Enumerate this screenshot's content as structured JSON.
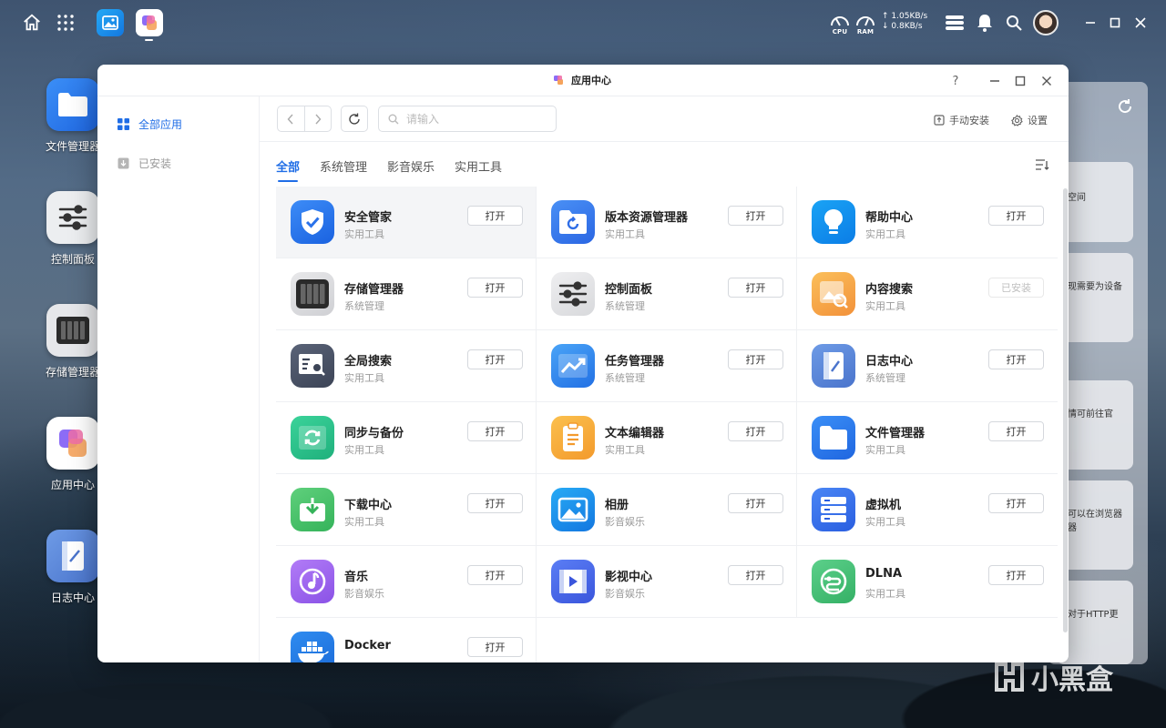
{
  "taskbar": {
    "cpu_label": "CPU",
    "ram_label": "RAM",
    "upload": "↑ 1.05KB/s",
    "download": "↓ 0.8KB/s"
  },
  "desktop": {
    "icons": [
      {
        "label": "文件管理器",
        "icon": "folder-icon"
      },
      {
        "label": "控制面板",
        "icon": "sliders-icon"
      },
      {
        "label": "存储管理器",
        "icon": "storage-icon"
      },
      {
        "label": "应用中心",
        "icon": "app-center-icon"
      },
      {
        "label": "日志中心",
        "icon": "log-icon"
      }
    ]
  },
  "background_window": {
    "snippets": [
      "空间",
      "现需要为设备",
      "情可前往官",
      "可以在浏览器\n器",
      "对于HTTP更"
    ]
  },
  "window": {
    "title": "应用中心",
    "help": "?"
  },
  "sidebar": {
    "items": [
      {
        "label": "全部应用",
        "active": true
      },
      {
        "label": "已安装",
        "active": false
      }
    ]
  },
  "toolbar": {
    "search_placeholder": "请输入",
    "manual_install": "手动安装",
    "settings": "设置"
  },
  "tabs": [
    {
      "label": "全部",
      "active": true
    },
    {
      "label": "系统管理",
      "active": false
    },
    {
      "label": "影音娱乐",
      "active": false
    },
    {
      "label": "实用工具",
      "active": false
    }
  ],
  "apps": [
    {
      "name": "安全管家",
      "category": "实用工具",
      "button": "打开",
      "icon": "shield-check-icon",
      "color1": "#3d8cf7",
      "color2": "#1a62e0"
    },
    {
      "name": "版本资源管理器",
      "category": "实用工具",
      "button": "打开",
      "icon": "restore-folder-icon",
      "color1": "#4a90f5",
      "color2": "#2a66e3"
    },
    {
      "name": "帮助中心",
      "category": "实用工具",
      "button": "打开",
      "icon": "lightbulb-icon",
      "color1": "#1aa3f5",
      "color2": "#0b7de6"
    },
    {
      "name": "存储管理器",
      "category": "系统管理",
      "button": "打开",
      "icon": "storage-icon",
      "color1": "#e8e8ea",
      "color2": "#cfd0d4"
    },
    {
      "name": "控制面板",
      "category": "系统管理",
      "button": "打开",
      "icon": "sliders-icon",
      "color1": "#eeeef0",
      "color2": "#d8d9dc"
    },
    {
      "name": "内容搜索",
      "category": "实用工具",
      "button": "已安装",
      "icon": "image-search-icon",
      "color1": "#fbbf5a",
      "color2": "#f2913a"
    },
    {
      "name": "全局搜索",
      "category": "实用工具",
      "button": "打开",
      "icon": "global-search-icon",
      "color1": "#5a6378",
      "color2": "#3c4456"
    },
    {
      "name": "任务管理器",
      "category": "系统管理",
      "button": "打开",
      "icon": "trend-chart-icon",
      "color1": "#4aa4f7",
      "color2": "#2270e4"
    },
    {
      "name": "日志中心",
      "category": "系统管理",
      "button": "打开",
      "icon": "log-icon",
      "color1": "#6e9be6",
      "color2": "#4a74cc"
    },
    {
      "name": "同步与备份",
      "category": "实用工具",
      "button": "打开",
      "icon": "sync-icon",
      "color1": "#3bd39a",
      "color2": "#1fb07c"
    },
    {
      "name": "文本编辑器",
      "category": "实用工具",
      "button": "打开",
      "icon": "clipboard-icon",
      "color1": "#fbc04e",
      "color2": "#f39a2c"
    },
    {
      "name": "文件管理器",
      "category": "实用工具",
      "button": "打开",
      "icon": "folder-icon",
      "color1": "#3b8ff7",
      "color2": "#1f66e0"
    },
    {
      "name": "下载中心",
      "category": "实用工具",
      "button": "打开",
      "icon": "download-icon",
      "color1": "#5fd07c",
      "color2": "#35b35a"
    },
    {
      "name": "相册",
      "category": "影音娱乐",
      "button": "打开",
      "icon": "photo-icon",
      "color1": "#27aaf5",
      "color2": "#1377e0"
    },
    {
      "name": "虚拟机",
      "category": "实用工具",
      "button": "打开",
      "icon": "server-icon",
      "color1": "#4a86f5",
      "color2": "#2a5ee0"
    },
    {
      "name": "音乐",
      "category": "影音娱乐",
      "button": "打开",
      "icon": "music-icon",
      "color1": "#b27cf7",
      "color2": "#8a52e6"
    },
    {
      "name": "影视中心",
      "category": "影音娱乐",
      "button": "打开",
      "icon": "video-icon",
      "color1": "#5b7ef5",
      "color2": "#3a55dc"
    },
    {
      "name": "DLNA",
      "category": "实用工具",
      "button": "打开",
      "icon": "dlna-icon",
      "color1": "#5cd08a",
      "color2": "#34b065"
    },
    {
      "name": "Docker",
      "category": "",
      "button": "打开",
      "icon": "docker-icon",
      "color1": "#2f8cf0",
      "color2": "#1b6ad8"
    }
  ],
  "watermark": "小黑盒"
}
